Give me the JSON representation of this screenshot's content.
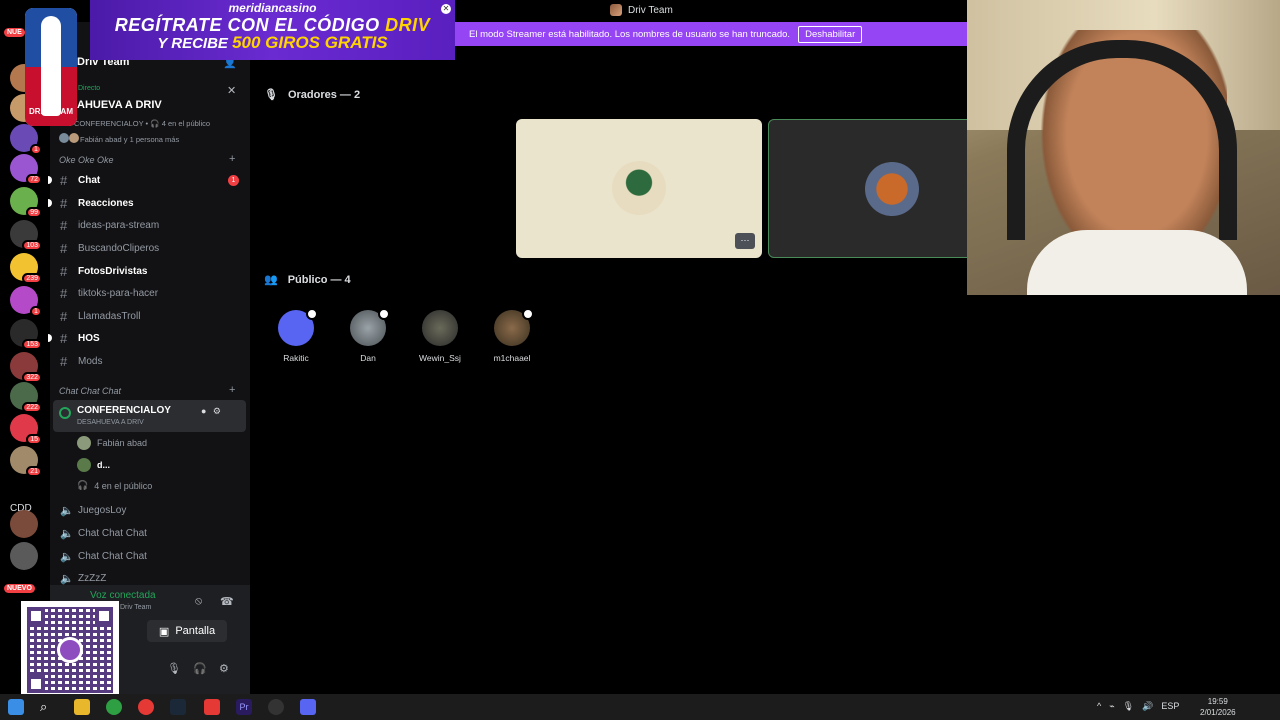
{
  "window": {
    "title": "Driv Team"
  },
  "ad": {
    "brand": "meridiancasino",
    "line1_a": "REGÍTRATE CON EL CÓDIGO",
    "line1_b": "DRIV",
    "line2_a": "Y RECIBE",
    "line2_b": "500 GIROS GRATIS"
  },
  "logo": {
    "text": "DRIV TEAM"
  },
  "banner": {
    "message": "El modo Streamer está habilitado. Los nombres de usuario se han truncado.",
    "button": "Deshabilitar"
  },
  "rail": {
    "badges": [
      "1",
      "72",
      "99",
      "103",
      "239",
      "1",
      "153",
      "322",
      "222",
      "15",
      "21"
    ],
    "cdd_label": "CDD",
    "new_label": "NUEVO",
    "top_label": "NUE"
  },
  "sidebar": {
    "server_name": "Driv Team",
    "live": {
      "tag": "Directo",
      "name": "AHUEVA A DRIV",
      "channel": "CONFERENCIALOY",
      "listeners": "4 en el público",
      "people": "Fabián abad y 1 persona más"
    },
    "category1": "Oke Oke Oke",
    "channels": [
      {
        "label": "Chat",
        "unread": true,
        "mention": "1"
      },
      {
        "label": "Reacciones",
        "unread": true
      },
      {
        "label": "ideas-para-stream",
        "unread": false
      },
      {
        "label": "BuscandoCliperos",
        "unread": false
      },
      {
        "label": "FotosDrivistas",
        "unread": true
      },
      {
        "label": "tiktoks-para-hacer",
        "unread": false
      },
      {
        "label": "LlamadasTroll",
        "unread": false
      },
      {
        "label": "HOS",
        "unread": true
      },
      {
        "label": "Mods",
        "unread": false
      }
    ],
    "category2": "Chat Chat Chat",
    "voice_channel": {
      "name": "CONFERENCIALOY",
      "topic": "DESAHUEVA A DRIV",
      "members": [
        "Fabián abad",
        "d..."
      ],
      "audience": "4 en el público"
    },
    "other_voice": [
      "JuegosLoy",
      "Chat Chat Chat",
      "Chat Chat Chat",
      "ZzZzZ"
    ]
  },
  "voice_footer": {
    "status": "Voz conectada",
    "server": "Driv Team",
    "screen_button": "Pantalla"
  },
  "main": {
    "speakers_title": "Oradores — 2",
    "audience_title": "Público — 4",
    "more_label": "···",
    "audience": [
      "Rakitic",
      "Dan",
      "Wewin_Ssj",
      "m1chaael"
    ]
  },
  "taskbar": {
    "lang": "ESP",
    "time": "19:59",
    "date": "2/01/2026"
  },
  "colors": {
    "accent": "#9645f5",
    "online": "#23a55a",
    "mention": "#f23f43"
  }
}
